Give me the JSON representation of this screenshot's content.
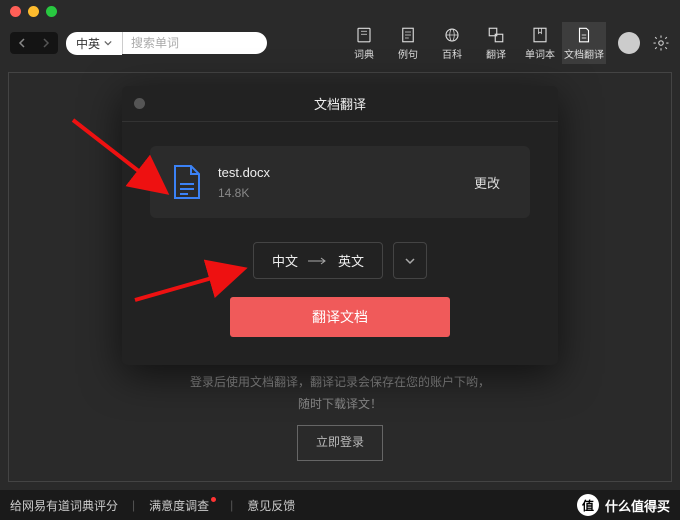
{
  "toolbar": {
    "lang_pair": "中英",
    "search_placeholder": "搜索单词"
  },
  "tabs": [
    {
      "label": "词典"
    },
    {
      "label": "例句"
    },
    {
      "label": "百科"
    },
    {
      "label": "翻译"
    },
    {
      "label": "单词本"
    },
    {
      "label": "文档翻译"
    }
  ],
  "modal": {
    "title": "文档翻译",
    "file_name": "test.docx",
    "file_size": "14.8K",
    "change_label": "更改",
    "lang_from": "中文",
    "lang_to": "英文",
    "translate_label": "翻译文档"
  },
  "hint": {
    "line1": "登录后使用文档翻译，翻译记录会保存在您的账户下哟，",
    "line2": "随时下载译文！",
    "login": "立即登录"
  },
  "footer": {
    "rate": "给网易有道词典评分",
    "survey": "满意度调查",
    "feedback": "意见反馈"
  },
  "brand": "什么值得买",
  "brand_mark": "值"
}
